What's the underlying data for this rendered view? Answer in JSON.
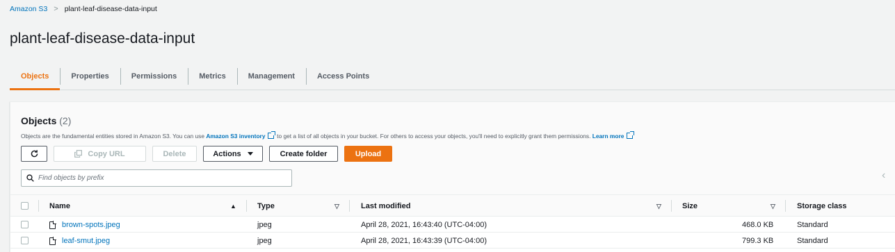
{
  "breadcrumb": {
    "root": "Amazon S3",
    "separator": ">",
    "current": "plant-leaf-disease-data-input"
  },
  "page_title": "plant-leaf-disease-data-input",
  "tabs": [
    "Objects",
    "Properties",
    "Permissions",
    "Metrics",
    "Management",
    "Access Points"
  ],
  "active_tab": "Objects",
  "objects": {
    "title": "Objects",
    "count": "(2)",
    "description": {
      "part1": "Objects are the fundamental entities stored in Amazon S3. You can use ",
      "inventory_link": "Amazon S3 inventory",
      "part2": " to get a list of all objects in your bucket. For others to access your objects, you'll need to explicitly grant them permissions. ",
      "learn_more": "Learn more"
    }
  },
  "toolbar": {
    "copy_url": "Copy URL",
    "delete": "Delete",
    "actions": "Actions",
    "create_folder": "Create folder",
    "upload": "Upload"
  },
  "search": {
    "placeholder": "Find objects by prefix"
  },
  "table": {
    "columns": {
      "name": "Name",
      "type": "Type",
      "last_modified": "Last modified",
      "size": "Size",
      "storage_class": "Storage class"
    },
    "rows": [
      {
        "name": "brown-spots.jpeg",
        "type": "jpeg",
        "last_modified": "April 28, 2021, 16:43:40 (UTC-04:00)",
        "size": "468.0 KB",
        "storage_class": "Standard"
      },
      {
        "name": "leaf-smut.jpeg",
        "type": "jpeg",
        "last_modified": "April 28, 2021, 16:43:39 (UTC-04:00)",
        "size": "799.3 KB",
        "storage_class": "Standard"
      }
    ]
  },
  "colors": {
    "link": "#0073bb",
    "accent": "#ec7211",
    "text": "#16191f",
    "background": "#f2f3f3"
  },
  "icons": [
    "refresh-icon",
    "copy-icon",
    "caret-down-icon",
    "search-icon",
    "external-link-icon",
    "file-icon",
    "sort-ascending-icon",
    "sort-icon",
    "chevron-left-icon"
  ]
}
